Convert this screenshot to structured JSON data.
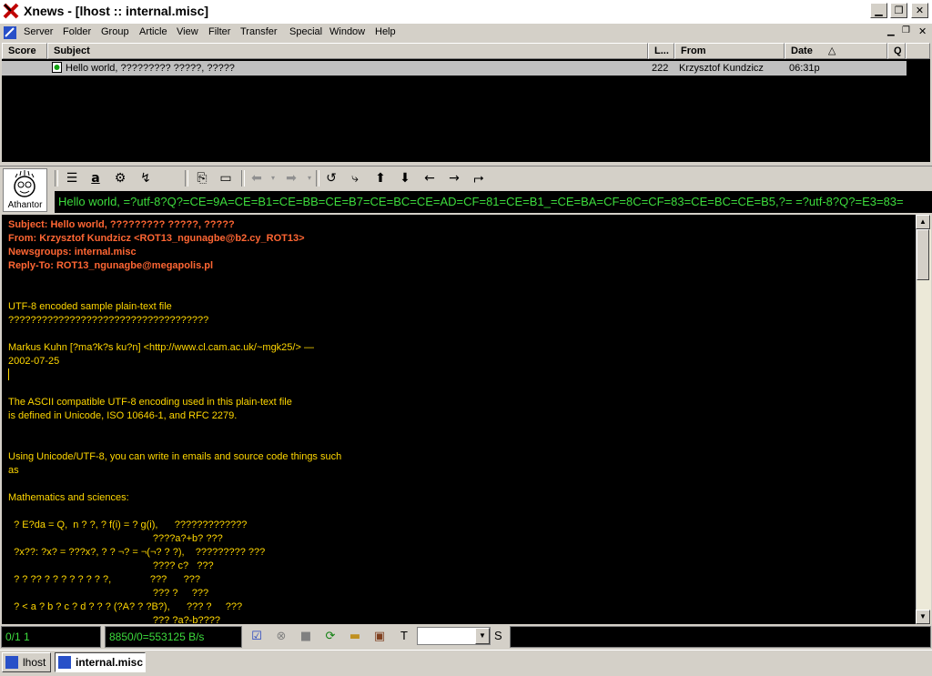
{
  "window": {
    "title": "Xnews - [lhost :: internal.misc]"
  },
  "menu": [
    "Server",
    "Folder",
    "Group",
    "Article",
    "View",
    "Filter",
    "Transfer",
    "Special",
    "Window",
    "Help"
  ],
  "list": {
    "columns": [
      "Score",
      "Subject",
      "L...",
      "From",
      "Date",
      "Q"
    ],
    "rows": [
      {
        "subject": "Hello world, ????????? ?????, ?????",
        "lines": "222",
        "from": "Krzysztof Kundzicz",
        "date": "06:31p"
      }
    ]
  },
  "logo_label": "Athantor",
  "subject_banner": "Hello world, =?utf-8?Q?=CE=9A=CE=B1=CE=BB=CE=B7=CE=BC=CE=AD=CF=81=CE=B1_=CE=BA=CF=8C=CF=83=CE=BC=CE=B5,?= =?utf-8?Q?=E3=83=",
  "article": {
    "headers": [
      "Subject: Hello world, ????????? ?????, ?????",
      "From: Krzysztof Kundzicz <ROT13_ngunagbe@b2.cy_ROT13>",
      "Newsgroups: internal.misc",
      "Reply-To: ROT13_ngunagbe@megapolis.pl"
    ],
    "lines": [
      "UTF-8 encoded sample plain-text file",
      "????????????????????????????????????",
      "Markus Kuhn [?ma?k?s ku?n] <http://www.cl.cam.ac.uk/~mgk25/> —",
      "2002-07-25",
      "The ASCII compatible UTF-8 encoding used in this plain-text file",
      "is defined in Unicode, ISO 10646-1, and RFC 2279.",
      "Using Unicode/UTF-8, you can write in emails and source code things such",
      "as",
      "Mathematics and sciences:",
      "  ? E?da = Q,  n ? ?, ? f(i) = ? g(i),      ?????????????",
      "                                                    ????a?+b? ???",
      "  ?x??: ?x? = ???x?, ? ? ¬? = ¬(¬? ? ?),    ????????? ???",
      "                                                    ???? c?   ???",
      "  ? ? ?? ? ? ? ? ? ? ? ?,              ???      ???",
      "                                                    ??? ?     ???",
      "  ? < a ? b ? c ? d ? ? ? (?A? ? ?B?),      ??? ?     ???",
      "                                                    ??? ?a?-b????"
    ]
  },
  "status": {
    "counts": "0/1 1",
    "speed": "8850/0=553125 B/s",
    "t_label": "T",
    "s_label": "S"
  },
  "taskbar": [
    "lhost",
    "internal.misc"
  ],
  "colors": {
    "body_text": "#ffd700",
    "header_text": "#ff6633",
    "banner_text": "#3ddc3d"
  }
}
